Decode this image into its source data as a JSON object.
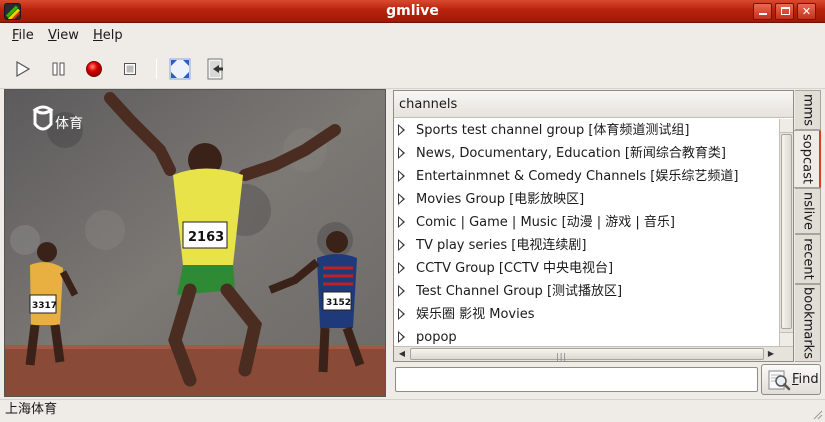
{
  "window": {
    "title": "gmlive",
    "minimize_glyph": "",
    "close_glyph": "✕"
  },
  "menu": [
    {
      "label_u": "F",
      "label_rest": "ile"
    },
    {
      "label_u": "V",
      "label_rest": "iew"
    },
    {
      "label_u": "H",
      "label_rest": "elp"
    }
  ],
  "toolbar": {
    "icons": [
      "play-icon",
      "pause-icon",
      "record-icon",
      "stop-icon",
      "fullscreen-icon",
      "exit-icon"
    ]
  },
  "video": {
    "channel_logo_text": "体育",
    "bib_center": "2163",
    "bib_left": "3317",
    "bib_right": "3152"
  },
  "channels": {
    "header": "channels",
    "items": [
      "Sports test channel group [体育频道测试组]",
      "News, Documentary, Education [新闻综合教育类]",
      "Entertainmnet  & Comedy  Channels [娱乐综艺频道]",
      "Movies Group [电影放映区]",
      "Comic | Game | Music [动漫 |  游戏  | 音乐]",
      "TV play series [电视连续剧]",
      "CCTV Group [CCTV 中央电视台]",
      "Test Channel Group [测试播放区]",
      "娱乐圈 影视 Movies",
      "popop"
    ],
    "hscroll_grip": "|||"
  },
  "tabs": [
    "mms",
    "sopcast",
    "nslive",
    "recent",
    "bookmarks"
  ],
  "search": {
    "value": "",
    "find_u": "F",
    "find_rest": "ind"
  },
  "status": {
    "text": "上海体育"
  },
  "colors": {
    "titlebar": "#b9220c",
    "accent": "#d94020"
  }
}
